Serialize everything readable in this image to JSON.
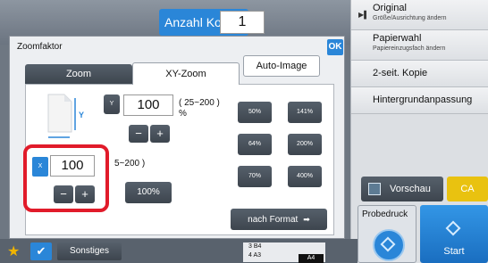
{
  "header": {
    "copies_label": "Anzahl Kopien",
    "copies_value": "1"
  },
  "dialog": {
    "title": "Zoomfaktor",
    "ok_label": "OK",
    "tabs": [
      {
        "label": "Zoom",
        "active": false
      },
      {
        "label": "XY-Zoom",
        "active": true
      }
    ],
    "auto_image_label": "Auto-Image",
    "y": {
      "axis_label": "Y",
      "value": "100",
      "range": "( 25~200 )",
      "percent": "%",
      "minus": "−",
      "plus": "+"
    },
    "x": {
      "axis_label": "X",
      "value": "100",
      "range": "5~200 )",
      "minus": "−",
      "plus": "+"
    },
    "presets": [
      "50%",
      "141%",
      "64%",
      "200%",
      "70%",
      "400%"
    ],
    "reset_label": "100%",
    "format_label": "nach Format",
    "format_arrow": "➡"
  },
  "right_panel": {
    "items": [
      {
        "title": "Original",
        "subtitle": "Größe/Ausrichtung ändern"
      },
      {
        "title": "Papierwahl",
        "subtitle": "Papiereinzugsfach ändern"
      },
      {
        "title": "2-seit. Kopie",
        "subtitle": ""
      },
      {
        "title": "Hintergrundanpassung",
        "subtitle": ""
      }
    ],
    "preview_label": "Vorschau",
    "ca_label": "CA",
    "proof_label": "Probedruck",
    "start_label": "Start"
  },
  "bottom_bar": {
    "other_label": "Sonstiges",
    "tray_row1": "3   B4",
    "tray_row2": "4   A3",
    "paper_badge": "A4"
  },
  "colors": {
    "accent_blue": "#2a86d8",
    "highlight_red": "#e11b2a",
    "ca_yellow": "#e9c210"
  },
  "icons": {
    "favorite": "star-icon",
    "confirm": "check-icon",
    "preview": "preview-icon",
    "start": "diamond-icon",
    "arrow": "arrow-right-icon"
  }
}
